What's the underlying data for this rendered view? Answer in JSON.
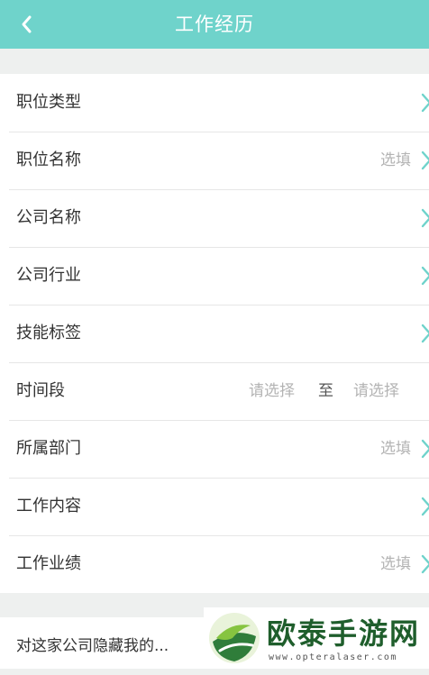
{
  "header": {
    "title": "工作经历"
  },
  "form": {
    "rows": [
      {
        "label": "职位类型",
        "value": ""
      },
      {
        "label": "职位名称",
        "value": "选填"
      },
      {
        "label": "公司名称",
        "value": ""
      },
      {
        "label": "公司行业",
        "value": ""
      },
      {
        "label": "技能标签",
        "value": ""
      },
      {
        "label": "时间段"
      },
      {
        "label": "所属部门",
        "value": "选填"
      },
      {
        "label": "工作内容",
        "value": ""
      },
      {
        "label": "工作业绩",
        "value": "选填"
      }
    ],
    "time": {
      "start_placeholder": "请选择",
      "separator": "至",
      "end_placeholder": "请选择"
    }
  },
  "hide_section": {
    "label": "对这家公司隐藏我的..."
  },
  "watermark": {
    "title": "欧泰手游网",
    "url": "www.opteralaser.com"
  },
  "colors": {
    "header_bg": "#6fd3cb",
    "arrow": "#6fd3cb",
    "placeholder": "#b3b3b3"
  }
}
